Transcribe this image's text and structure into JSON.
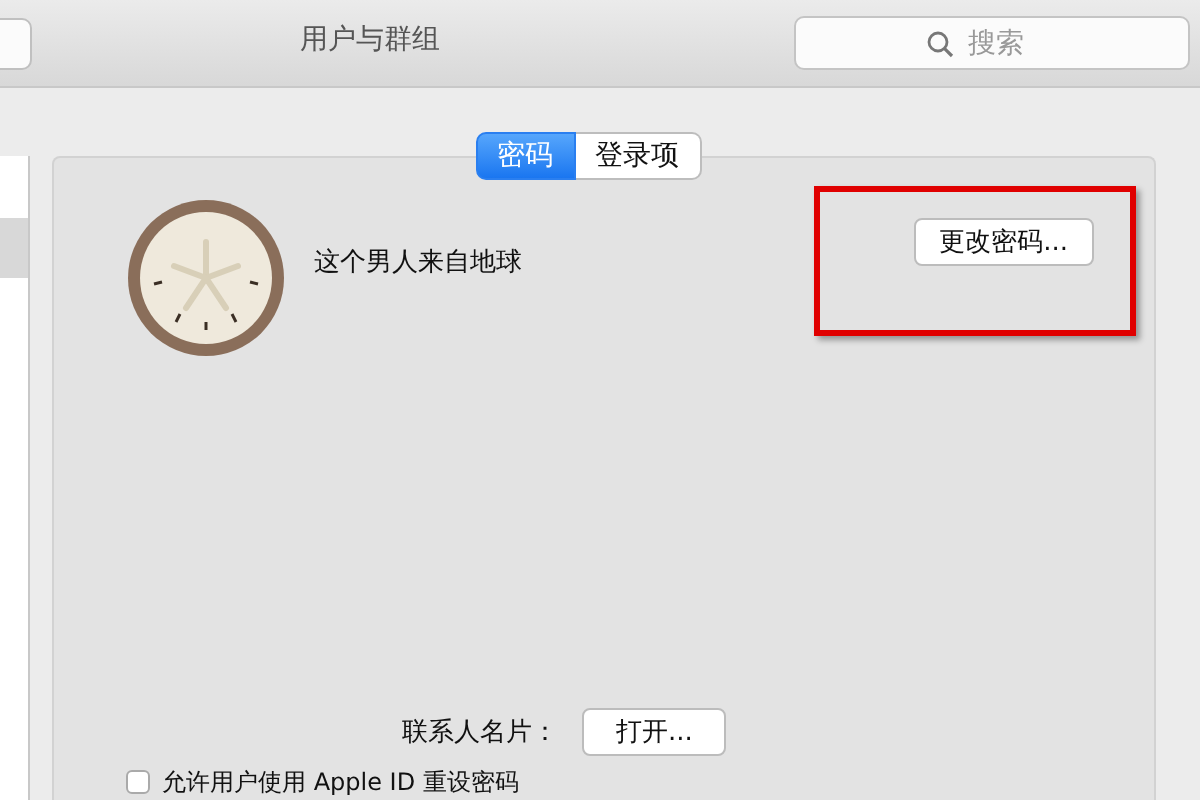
{
  "window": {
    "title": "用户与群组"
  },
  "toolbar": {
    "search": {
      "placeholder": "搜索"
    }
  },
  "tabs": [
    {
      "label": "密码",
      "selected": true
    },
    {
      "label": "登录项",
      "selected": false
    }
  ],
  "user": {
    "name": "这个男人来自地球",
    "change_password_button": "更改密码..."
  },
  "annotation": {
    "kind": "rectangle",
    "color": "#e00000"
  },
  "contact_card": {
    "label": "联系人名片：",
    "button": "打开..."
  },
  "apple_id_reset": {
    "label": "允许用户使用 Apple ID 重设密码",
    "checked": false
  }
}
